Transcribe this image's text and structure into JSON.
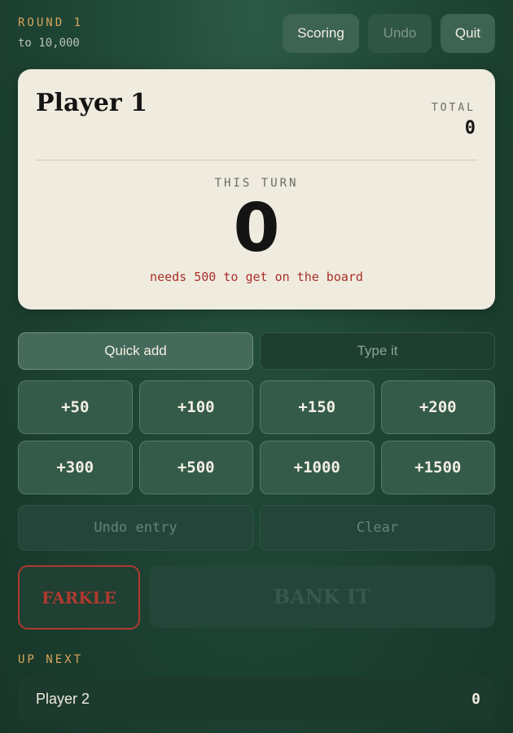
{
  "header": {
    "round": "ROUND 1",
    "target": "to 10,000",
    "buttons": {
      "scoring": "Scoring",
      "undo": "Undo",
      "quit": "Quit"
    }
  },
  "card": {
    "player_name": "Player 1",
    "total_label": "TOTAL",
    "total_value": "0",
    "turn_label": "THIS TURN",
    "turn_value": "0",
    "hint": "needs 500 to get on the board"
  },
  "tabs": {
    "quick_add": "Quick add",
    "type_it": "Type it",
    "active": "quick_add"
  },
  "quick_values": [
    "+50",
    "+100",
    "+150",
    "+200",
    "+300",
    "+500",
    "+1000",
    "+1500"
  ],
  "secondary": {
    "undo_entry": "Undo entry",
    "clear": "Clear"
  },
  "actions": {
    "farkle": "FARKLE",
    "bank": "BANK IT"
  },
  "up_next": {
    "label": "UP NEXT",
    "players": [
      {
        "name": "Player 2",
        "score": "0"
      }
    ]
  },
  "colors": {
    "accent_gold": "#d9a55a",
    "danger_red": "#b0392f",
    "card_bg": "#f0ebdf",
    "bg_green": "#1f4736"
  }
}
